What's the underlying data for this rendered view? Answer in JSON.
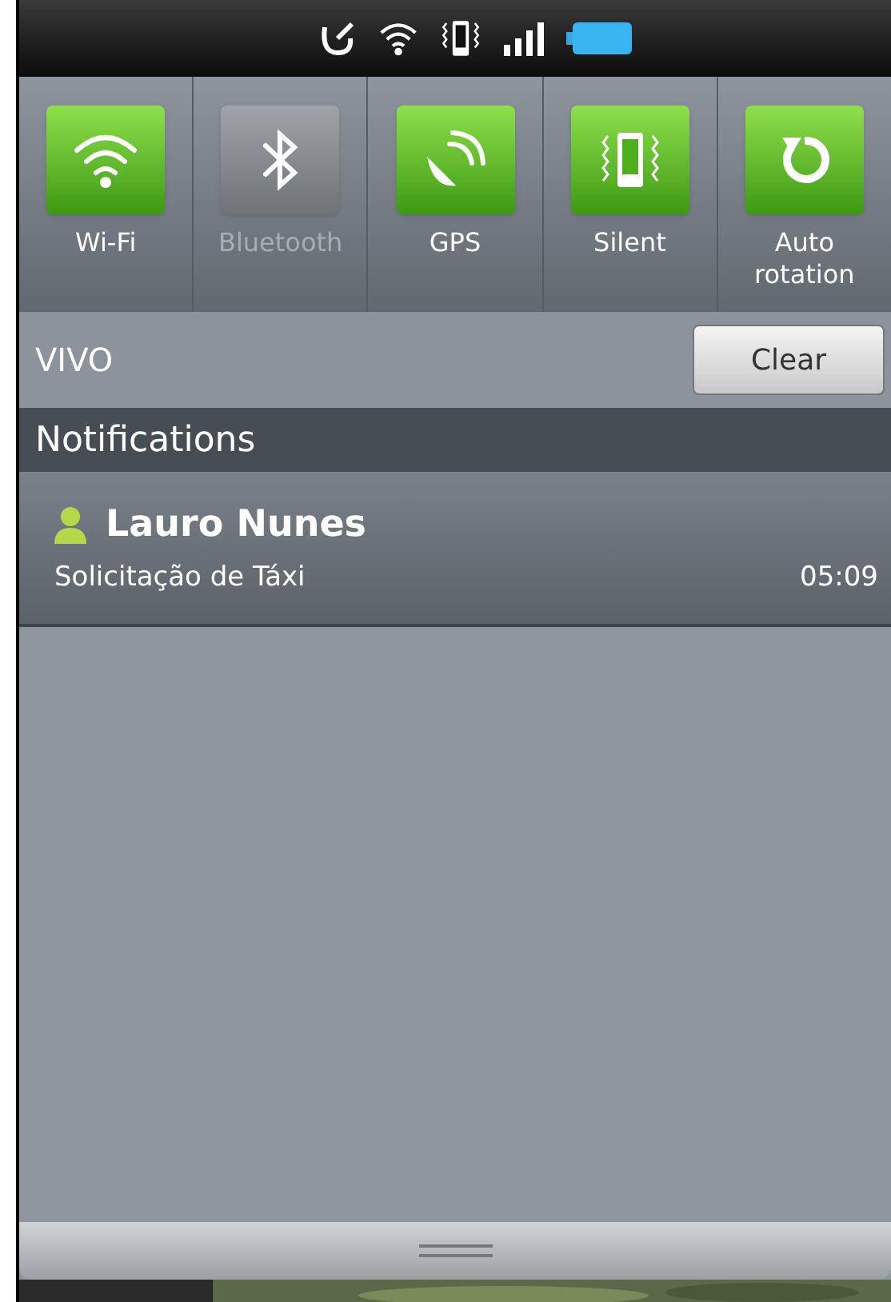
{
  "toggles": [
    {
      "kind": "wifi",
      "label": "Wi-Fi",
      "on": true
    },
    {
      "kind": "bluetooth",
      "label": "Bluetooth",
      "on": false
    },
    {
      "kind": "gps",
      "label": "GPS",
      "on": true
    },
    {
      "kind": "vibrate",
      "label": "Silent",
      "on": true
    },
    {
      "kind": "rotate",
      "label": "Auto rotation",
      "on": true
    }
  ],
  "carrier": "VIVO",
  "clear_button": "Clear",
  "section_title": "Notifications",
  "notifications": [
    {
      "title": "Lauro Nunes",
      "text": "Solicitação de Táxi",
      "time": "05:09"
    }
  ]
}
